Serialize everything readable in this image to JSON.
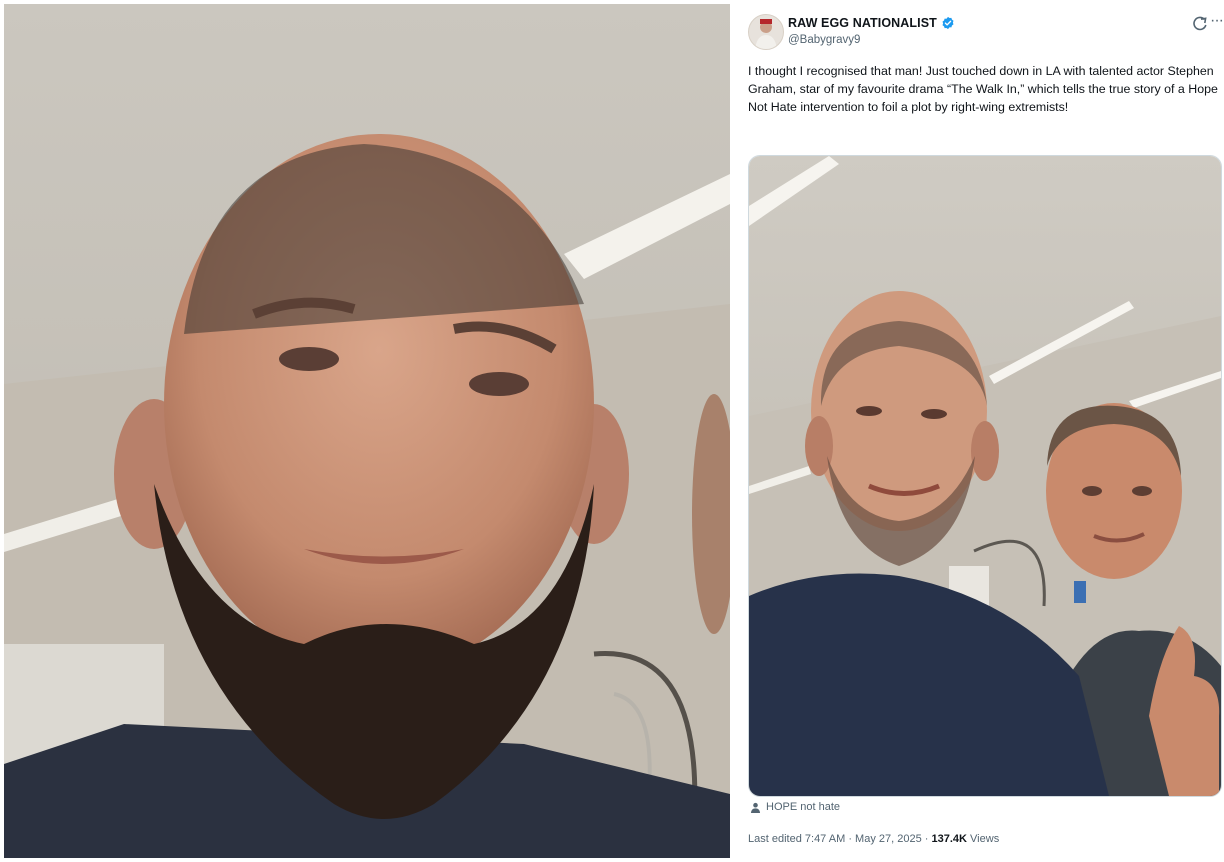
{
  "tweet": {
    "display_name": "RAW EGG NATIONALIST",
    "handle": "@Babygravy9",
    "verified_color": "#1d9bf0",
    "icons": [
      "avatar",
      "verified-badge-icon",
      "grok-icon",
      "more-options-icon",
      "person-icon"
    ],
    "text": "I thought I recognised that man! Just touched down in LA with talented actor Stephen Graham, star of my favourite drama “The Walk In,” which tells the true story of a Hope Not Hate intervention to foil a plot by right-wing extremists!",
    "media_credit": "HOPE not hate",
    "edited_label": "Last edited",
    "time": "7:47 AM",
    "separator": "·",
    "date": "May 27, 2025",
    "views_count": "137.4K",
    "views_label": "Views"
  }
}
